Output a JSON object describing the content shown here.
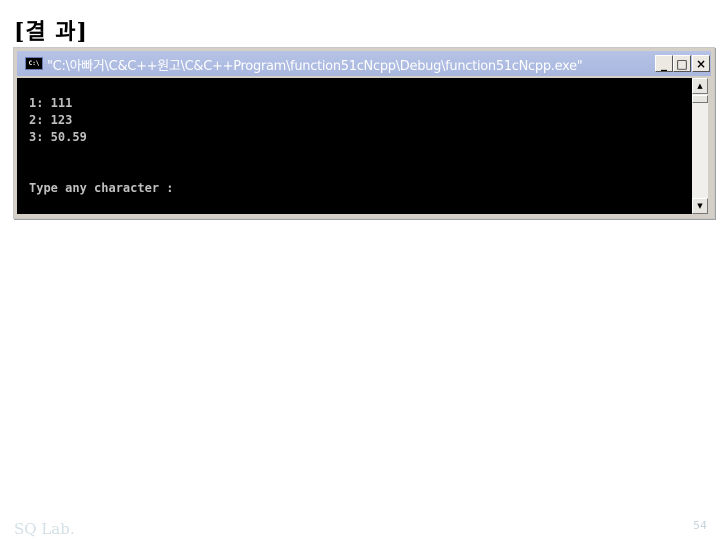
{
  "slide": {
    "heading": "[결 과]",
    "footer_left": "SQ Lab.",
    "page_number": "54"
  },
  "window": {
    "icon": "console-icon",
    "icon_text": "C:\\",
    "title": "\"C:\\아빠거\\C&C++원고\\C&C++Program\\function51cNcpp\\Debug\\function51cNcpp.exe\"",
    "controls": {
      "minimize": "_",
      "maximize": "□",
      "close": "×"
    }
  },
  "console": {
    "lines": [
      "1: 111",
      "2: 123",
      "3: 50.59",
      "Type any character :"
    ]
  },
  "scrollbar": {
    "up": "▲",
    "down": "▼"
  }
}
